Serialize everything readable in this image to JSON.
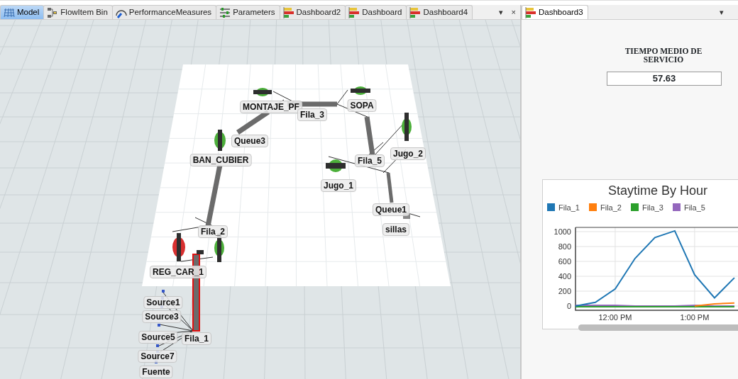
{
  "left_pane": {
    "tabs": [
      {
        "label": "Model",
        "selected": true
      },
      {
        "label": "FlowItem Bin",
        "selected": false
      },
      {
        "label": "PerformanceMeasures",
        "selected": false
      },
      {
        "label": "Parameters",
        "selected": false
      },
      {
        "label": "Dashboard2",
        "selected": false
      },
      {
        "label": "Dashboard",
        "selected": false
      },
      {
        "label": "Dashboard4",
        "selected": false
      }
    ],
    "menu": "▾",
    "close": "×",
    "model_view": {
      "labels": [
        {
          "text": "MONTAJE_PF"
        },
        {
          "text": "Fila_3"
        },
        {
          "text": "SOPA"
        },
        {
          "text": "Queue3"
        },
        {
          "text": "BAN_CUBIER"
        },
        {
          "text": "Fila_5"
        },
        {
          "text": "Jugo_2"
        },
        {
          "text": "Jugo_1"
        },
        {
          "text": "Queue1"
        },
        {
          "text": "sillas"
        },
        {
          "text": "Fila_2"
        },
        {
          "text": "REG_CAR_1"
        },
        {
          "text": "Source1"
        },
        {
          "text": "Source3"
        },
        {
          "text": "Source5"
        },
        {
          "text": "Fila_1"
        },
        {
          "text": "Source7"
        },
        {
          "text": "Fuente"
        }
      ]
    }
  },
  "right_pane": {
    "tabs": [
      {
        "label": "Dashboard3",
        "selected": true
      }
    ],
    "menu": "▾",
    "stat": {
      "title": "TIEMPO MEDIO DE SERVICIO",
      "value": "57.63"
    },
    "chart": {
      "chart_data": {
        "type": "line",
        "title": "Staytime By Hour",
        "x": [
          11.5,
          11.75,
          12,
          12.25,
          12.5,
          12.75,
          13,
          13.25,
          13.5
        ],
        "xlim": [
          11.5,
          13.68
        ],
        "ylim": [
          -57,
          1057
        ],
        "grid": true,
        "legend": "top",
        "xticks": [
          {
            "value": 12,
            "label": "12:00 PM"
          },
          {
            "value": 13,
            "label": "1:00 PM"
          }
        ],
        "yticks": [
          0,
          200,
          400,
          600,
          800,
          1000
        ],
        "series": [
          {
            "name": "Fila_1",
            "color": "#1f77b4",
            "values": [
              0,
              50,
              230,
              640,
              920,
              1010,
              420,
              110,
              380
            ]
          },
          {
            "name": "Fila_2",
            "color": "#ff7f0e",
            "values": [
              null,
              null,
              null,
              null,
              null,
              null,
              0,
              30,
              40
            ]
          },
          {
            "name": "Fila_3",
            "color": "#2ca02c",
            "values": [
              -10,
              -10,
              -10,
              -10,
              -10,
              -10,
              -10,
              -10,
              -10
            ]
          },
          {
            "name": "Fila_5",
            "color": "#9467bd",
            "values": [
              10,
              10,
              10,
              0,
              0,
              0,
              10,
              0,
              0
            ]
          }
        ]
      }
    }
  }
}
